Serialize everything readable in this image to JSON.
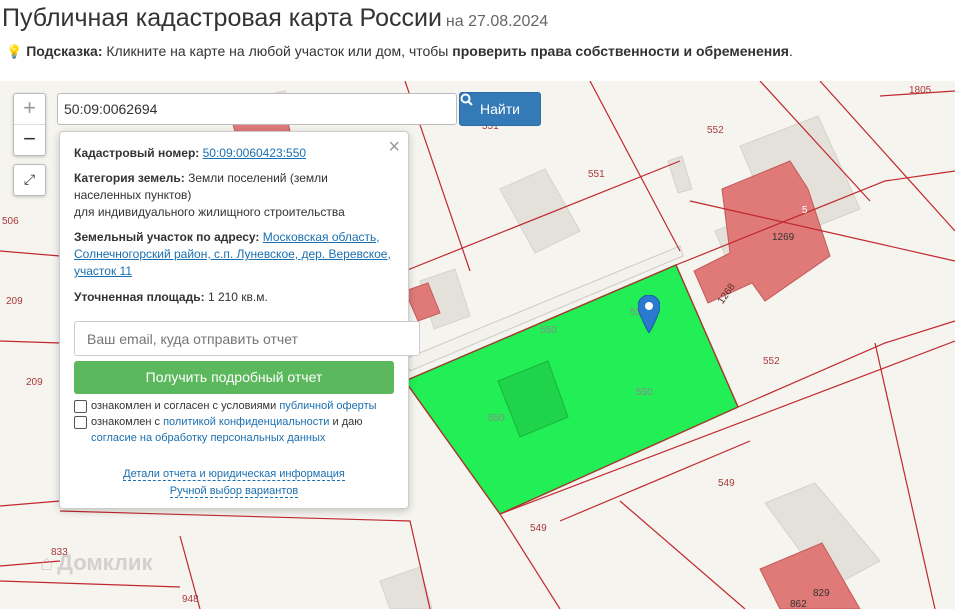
{
  "header": {
    "title": "Публичная кадастровая карта России",
    "date": "на 27.08.2024"
  },
  "hint": {
    "label": "Подсказка:",
    "text": "Кликните на карте на любой участок или дом, чтобы",
    "bold_text": "проверить права собственности и обременения",
    "end": "."
  },
  "search": {
    "value": "50:09:0062694",
    "button_label": "Найти"
  },
  "map_controls": {
    "zoom_in": "+",
    "zoom_out": "−",
    "fullscreen": "⤢"
  },
  "popup": {
    "close": "×",
    "cadastral_label": "Кадастровый номер:",
    "cadastral_value": "50:09:0060423:550",
    "category_label": "Категория земель:",
    "category_value": "Земли поселений (земли населенных пунктов)",
    "category_use": "для индивидуального жилищного строительства",
    "address_label": "Земельный участок по адресу:",
    "address_value": "Московская область, Солнечногорский район, с.п. Луневское, дер. Веревское, участок 11",
    "area_label": "Уточненная площадь:",
    "area_value": "1 210 кв.м.",
    "email_placeholder": "Ваш email, куда отправить отчет",
    "report_button": "Получить подробный отчет",
    "checkbox1_text": "ознакомлен и согласен с условиями",
    "checkbox1_link": "публичной оферты",
    "checkbox2_text": "ознакомлен с",
    "checkbox2_link": "политикой конфиденциальности",
    "checkbox2_text2": "и даю",
    "checkbox2_link2": "согласие на обработку персональных данных",
    "details_link": "Детали отчета и юридическая информация",
    "manual_link": "Ручной выбор вариантов"
  },
  "map_labels": {
    "l1805": "1805",
    "l552a": "552",
    "l551a": "551",
    "l551b": "551",
    "l1269": "1269",
    "l1268": "1268",
    "l552b": "552",
    "l550a": "550",
    "l550b": "550",
    "l550c": "550",
    "l550d": "550",
    "l549a": "549",
    "l549b": "549",
    "l506": "506",
    "l209a": "209",
    "l209b": "209",
    "l833": "833",
    "l948": "948",
    "l829": "829",
    "l862": "862",
    "l5": "5"
  },
  "watermark": "Домклик",
  "colors": {
    "selected_parcel": "#22ee55",
    "building_highlight": "#e07a78",
    "boundary": "#c0282e",
    "button_primary": "#337ab7",
    "button_success": "#5cb85c"
  }
}
